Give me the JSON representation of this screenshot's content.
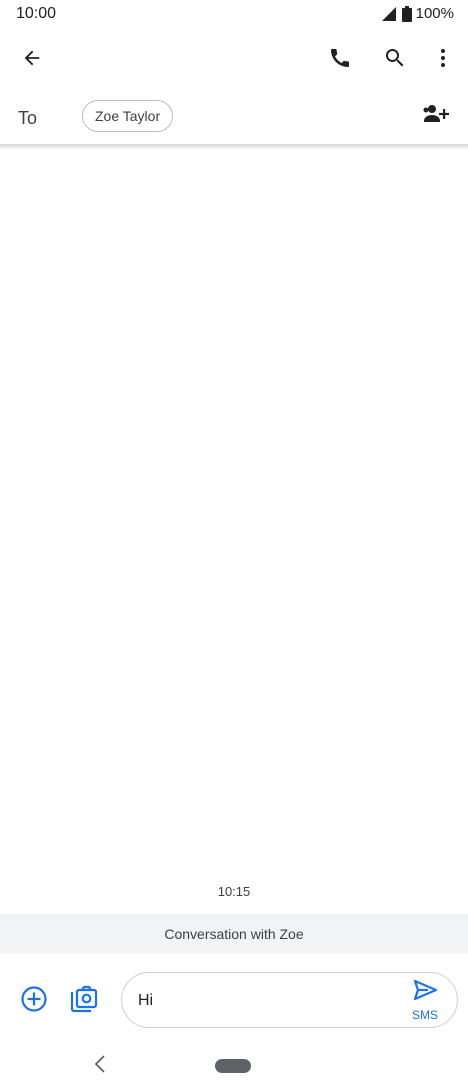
{
  "status_bar": {
    "time": "10:00",
    "battery_text": "100%",
    "icons": [
      "signal-icon",
      "battery-icon"
    ]
  },
  "app_bar": {
    "icons": [
      "back-arrow-icon",
      "phone-icon",
      "search-icon",
      "more-vert-icon"
    ]
  },
  "recipient": {
    "to_label": "To",
    "chip_name": "Zoe Taylor",
    "add_icon": "add-person-icon"
  },
  "conversation": {
    "timestamp": "10:15",
    "banner": "Conversation with Zoe"
  },
  "compose": {
    "message_value": "Hi",
    "send_label": "SMS",
    "icons": [
      "add-circle-icon",
      "camera-gallery-icon",
      "send-icon"
    ]
  },
  "colors": {
    "accent": "#1a73e8",
    "text": "#202124",
    "banner_bg": "#f1f3f4"
  }
}
